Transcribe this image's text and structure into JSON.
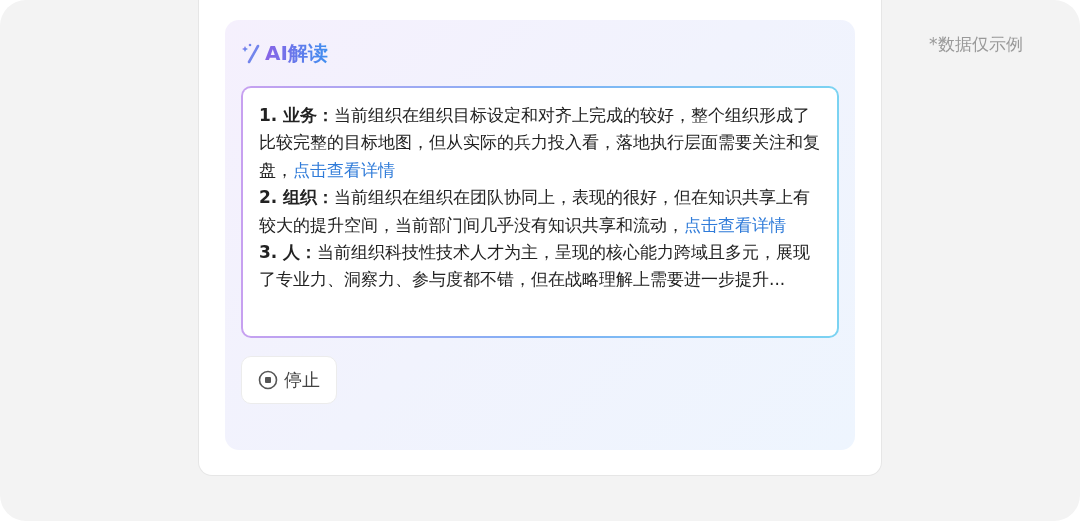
{
  "panel": {
    "title": "AI解读",
    "insights": [
      {
        "label": "1. 业务：",
        "text": "当前组织在组织目标设定和对齐上完成的较好，整个组织形成了比较完整的目标地图，但从实际的兵力投入看，落地执行层面需要关注和复盘，",
        "link": "点击查看详情"
      },
      {
        "label": "2. 组织：",
        "text": "当前组织在组织在团队协同上，表现的很好，但在知识共享上有较大的提升空间，当前部门间几乎没有知识共享和流动，",
        "link": "点击查看详情"
      },
      {
        "label": "3. 人：",
        "text": "当前组织科技性技术人才为主，呈现的核心能力跨域且多元，展现了专业力、洞察力、参与度都不错，但在战略理解上需要进一步提升..."
      }
    ],
    "stop_button": "停止"
  },
  "note": "*数据仅示例"
}
